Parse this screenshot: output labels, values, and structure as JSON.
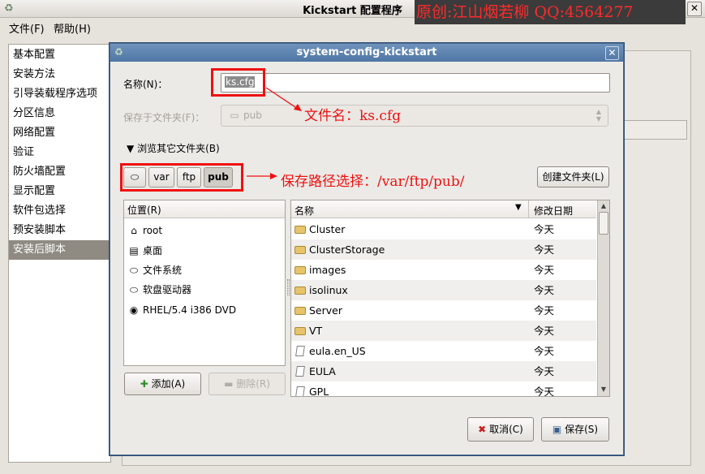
{
  "main_window": {
    "title": "Kickstart 配置程序",
    "watermark": "原创:江山烟若柳  QQ:4564277",
    "close_glyph": "✕"
  },
  "menu": {
    "file": "文件(F)",
    "help": "帮助(H)"
  },
  "sidebar": {
    "items": [
      {
        "label": "基本配置"
      },
      {
        "label": "安装方法"
      },
      {
        "label": "引导装载程序选项"
      },
      {
        "label": "分区信息"
      },
      {
        "label": "网络配置"
      },
      {
        "label": "验证"
      },
      {
        "label": "防火墙配置"
      },
      {
        "label": "显示配置"
      },
      {
        "label": "软件包选择"
      },
      {
        "label": "预安装脚本"
      },
      {
        "label": "安装后脚本",
        "selected": true
      }
    ]
  },
  "dialog": {
    "title": "system-config-kickstart",
    "name_label": "名称(N)：",
    "name_value": "ks.cfg",
    "save_in_label": "保存于文件夹(F)：",
    "save_in_value": "pub",
    "browse_label": "浏览其它文件夹(B)",
    "path_buttons": [
      "var",
      "ftp",
      "pub"
    ],
    "create_folder": "创建文件夹(L)",
    "places_header": "位置(R)",
    "places": [
      {
        "label": "root",
        "icon": "home-icon"
      },
      {
        "label": "桌面",
        "icon": "desktop-icon"
      },
      {
        "label": "文件系统",
        "icon": "drive-icon"
      },
      {
        "label": "软盘驱动器",
        "icon": "floppy-icon"
      },
      {
        "label": "RHEL/5.4 i386 DVD",
        "icon": "dvd-icon"
      }
    ],
    "add_button": "添加(A)",
    "remove_button": "删除(R)",
    "files_header": {
      "name": "名称",
      "modified": "修改日期"
    },
    "files": [
      {
        "name": "Cluster",
        "type": "folder",
        "modified": "今天"
      },
      {
        "name": "ClusterStorage",
        "type": "folder",
        "modified": "今天"
      },
      {
        "name": "images",
        "type": "folder",
        "modified": "今天"
      },
      {
        "name": "isolinux",
        "type": "folder",
        "modified": "今天"
      },
      {
        "name": "Server",
        "type": "folder",
        "modified": "今天"
      },
      {
        "name": "VT",
        "type": "folder",
        "modified": "今天"
      },
      {
        "name": "eula.en_US",
        "type": "file",
        "modified": "今天"
      },
      {
        "name": "EULA",
        "type": "file",
        "modified": "今天"
      },
      {
        "name": "GPL",
        "type": "file",
        "modified": "今天"
      }
    ],
    "cancel_button": "取消(C)",
    "save_button": "保存(S)"
  },
  "annotations": {
    "filename_note": "文件名：ks.cfg",
    "path_note": "保存路径选择：/var/ftp/pub/",
    "color": "#ee1111"
  }
}
